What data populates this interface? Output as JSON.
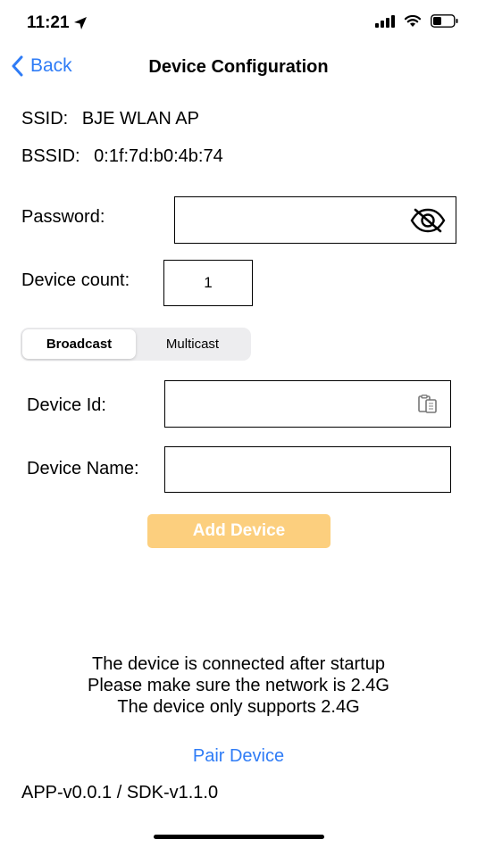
{
  "status_bar": {
    "time": "11:21",
    "icons": [
      "location-arrow-icon",
      "cellular-signal-icon",
      "wifi-icon",
      "battery-icon"
    ]
  },
  "nav": {
    "back_label": "Back",
    "title": "Device Configuration"
  },
  "network": {
    "ssid_label": "SSID:",
    "ssid_value": "BJE WLAN AP",
    "bssid_label": "BSSID:",
    "bssid_value": "0:1f:7d:b0:4b:74"
  },
  "form": {
    "password_label": "Password:",
    "password_value": "",
    "device_count_label": "Device count:",
    "device_count_value": "1",
    "segment": {
      "options": [
        "Broadcast",
        "Multicast"
      ],
      "selected": "Broadcast"
    },
    "device_id_label": "Device Id:",
    "device_id_value": "",
    "device_name_label": "Device Name:",
    "device_name_value": "",
    "add_button": "Add Device"
  },
  "notice": {
    "line1": "The device is connected after startup",
    "line2": "Please make sure the network is 2.4G",
    "line3": "The device only supports 2.4G"
  },
  "pair_link": "Pair Device",
  "version": "APP-v0.0.1 / SDK-v1.1.0",
  "colors": {
    "accent": "#2f7cf6",
    "add_button_bg": "#fccf7e",
    "segment_bg": "#ededef"
  }
}
